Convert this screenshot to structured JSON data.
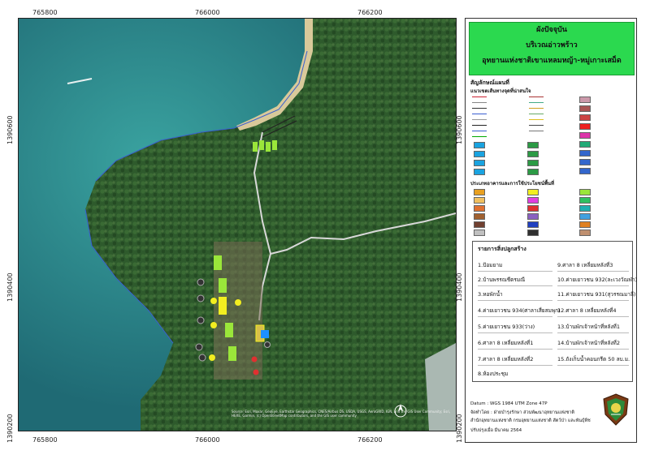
{
  "map": {
    "x_ticks": [
      "765800",
      "766000",
      "766200"
    ],
    "y_ticks": [
      "1390600",
      "1390400",
      "1390200"
    ],
    "attribution": "Source: Esri, Maxar, GeoEye, Earthstar Geographics, CNES/Airbus DS, USDA, USGS, AeroGRID, IGN, and the GIS User Community; Esri, HERE, Garmin, (c) OpenStreetMap contributors, and the GIS user community"
  },
  "title": {
    "line1": "ผังปัจจุบัน",
    "line2": "บริเวณอ่าวพร้าว",
    "line3": "อุทยานแห่งชาติเขาแหลมหญ้า-หมู่เกาะเสม็ด"
  },
  "legend": {
    "heading": "สัญลักษณ์แผนที่",
    "subheading": "แนวเขตเส้นทางจุดที่น่าสนใจ",
    "landuse_heading": "ประเภทอาคารและการใช้ประโยชน์พื้นที่"
  },
  "structures": {
    "heading": "รายการสิ่งปลูกสร้าง",
    "left": [
      "1.ป้อมยาม",
      "2.บ้านพรรณชีตรมณี",
      "3.หอพักน้ำ",
      "4.ค่ายเยาวชน 934(ศาลาเสี่ยสมพุก)",
      "5.ค่ายเยาวชน 933(ว่าง)",
      "6.ศาลา 8 เหลี่ยมหลังที่1",
      "7.ศาลา 8 เหลี่ยมหลังที่2",
      "8.ห้องประชุม"
    ],
    "right": [
      "9.ศาลา 8 เหลี่ยมหลังที่3",
      "10.ค่ายเยาวชน 932(ละเวงวัณฬา)",
      "11.ค่ายเยาวชน 931(สุวรรณมาลี)",
      "12.ศาลา 8 เหลี่ยมหลังที่4",
      "13.บ้านพักเจ้าหน้าที่หลังที่1",
      "14.บ้านพักเจ้าหน้าที่หลังที่2",
      "15.ถังเก็บน้ำคอนกรีต 50 ลบ.ม."
    ]
  },
  "footer": {
    "datum": "Datum : WGS 1984 UTM Zone 47P",
    "prepared_by": "จัดทำโดย : ฝ่ายบำรุงรักษา ส่วนพัฒนาอุทยานแห่งชาติ",
    "office": "สำนักอุทยานแห่งชาติ กรมอุทยานแห่งชาติ สัตว์ป่า และพันธุ์พืช",
    "updated": "ปรับปรุงเมื่อ มีนาคม 2564"
  },
  "colors": {
    "title_bg": "#2bd94f",
    "sea": "#2f7f86",
    "forest": "#2e5a2c",
    "building": "#9ae63a"
  }
}
